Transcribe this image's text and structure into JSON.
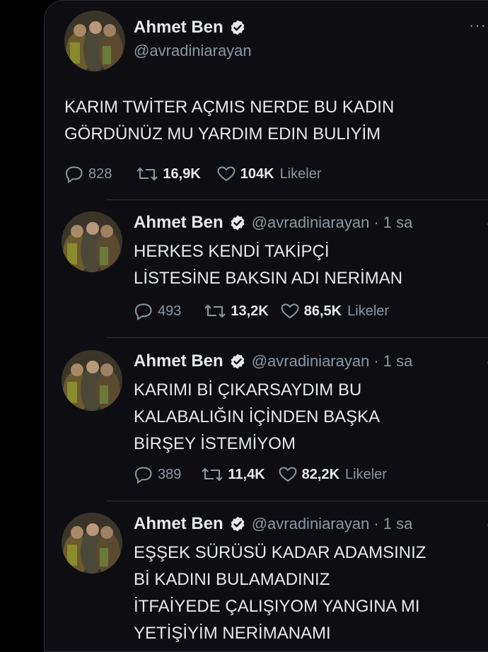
{
  "main_tweet": {
    "name": "Ahmet Ben",
    "handle": "@avradiniarayan",
    "more": "···",
    "lines": [
      "KARIM TWİTER AÇMIS NERDE BU KADIN",
      "GÖRDÜNÜZ MU YARDIM EDIN BULIYİM"
    ],
    "replies": "828",
    "retweets": "16,9K",
    "likes": "104K",
    "likes_label": "Likeler"
  },
  "replies": [
    {
      "name": "Ahmet Ben",
      "handle": "@avradiniarayan",
      "time": "· 1 sa",
      "more": "···",
      "lines": [
        "HERKES KENDİ TAKİPÇİ",
        "LİSTESİNE BAKSIN ADI NERİMAN"
      ],
      "replies": "493",
      "retweets": "13,2K",
      "likes": "86,5K",
      "likes_label": "Likeler"
    },
    {
      "name": "Ahmet Ben",
      "handle": "@avradiniarayan",
      "time": "· 1 sa",
      "more": "···",
      "lines": [
        "KARIMI Bİ ÇIKARSAYDIM BU",
        "KALABALIĞIN İÇİNDEN BAŞKA",
        "BİRŞEY İSTEMİYOM"
      ],
      "replies": "389",
      "retweets": "11,4K",
      "likes": "82,2K",
      "likes_label": "Likeler"
    },
    {
      "name": "Ahmet Ben",
      "handle": "@avradiniarayan",
      "time": "· 1 sa",
      "more": "···",
      "lines": [
        "EŞŞEK SÜRÜSÜ KADAR ADAMSINIZ",
        "Bİ KADINI BULAMADINIZ",
        "İTFAİYEDE ÇALIŞIYOM YANGINA MI",
        "YETİŞİYİM NERİMANAMI"
      ]
    }
  ],
  "icons": {
    "verified": "verified-badge-icon",
    "reply": "reply-icon",
    "retweet": "retweet-icon",
    "like": "heart-icon",
    "more": "more-options-icon",
    "avatar": "profile-photo"
  },
  "colors": {
    "background": "#000000",
    "card": "#0d0d12",
    "text": "#e7e9ea",
    "muted": "#8b98a5",
    "verified": "#1d9bf0",
    "divider": "#2f3336"
  }
}
